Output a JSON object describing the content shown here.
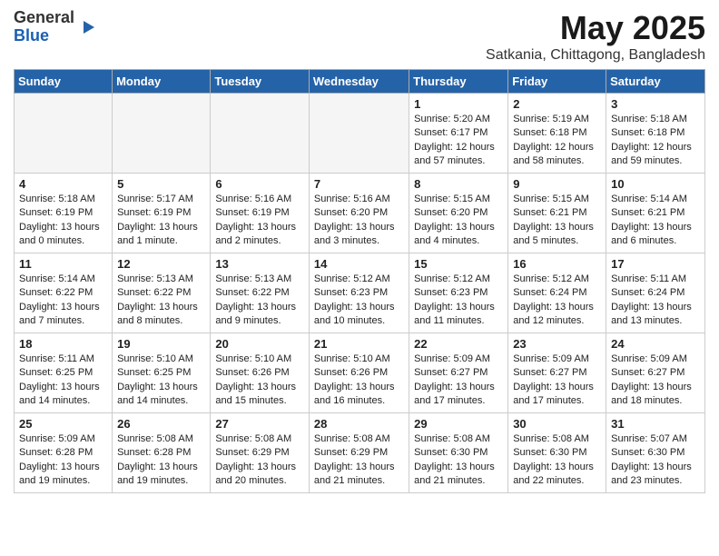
{
  "header": {
    "logo_general": "General",
    "logo_blue": "Blue",
    "title": "May 2025",
    "location": "Satkania, Chittagong, Bangladesh"
  },
  "weekdays": [
    "Sunday",
    "Monday",
    "Tuesday",
    "Wednesday",
    "Thursday",
    "Friday",
    "Saturday"
  ],
  "weeks": [
    [
      {
        "day": "",
        "empty": true
      },
      {
        "day": "",
        "empty": true
      },
      {
        "day": "",
        "empty": true
      },
      {
        "day": "",
        "empty": true
      },
      {
        "day": "1",
        "sunrise": "Sunrise: 5:20 AM",
        "sunset": "Sunset: 6:17 PM",
        "daylight": "Daylight: 12 hours and 57 minutes."
      },
      {
        "day": "2",
        "sunrise": "Sunrise: 5:19 AM",
        "sunset": "Sunset: 6:18 PM",
        "daylight": "Daylight: 12 hours and 58 minutes."
      },
      {
        "day": "3",
        "sunrise": "Sunrise: 5:18 AM",
        "sunset": "Sunset: 6:18 PM",
        "daylight": "Daylight: 12 hours and 59 minutes."
      }
    ],
    [
      {
        "day": "4",
        "sunrise": "Sunrise: 5:18 AM",
        "sunset": "Sunset: 6:19 PM",
        "daylight": "Daylight: 13 hours and 0 minutes."
      },
      {
        "day": "5",
        "sunrise": "Sunrise: 5:17 AM",
        "sunset": "Sunset: 6:19 PM",
        "daylight": "Daylight: 13 hours and 1 minute."
      },
      {
        "day": "6",
        "sunrise": "Sunrise: 5:16 AM",
        "sunset": "Sunset: 6:19 PM",
        "daylight": "Daylight: 13 hours and 2 minutes."
      },
      {
        "day": "7",
        "sunrise": "Sunrise: 5:16 AM",
        "sunset": "Sunset: 6:20 PM",
        "daylight": "Daylight: 13 hours and 3 minutes."
      },
      {
        "day": "8",
        "sunrise": "Sunrise: 5:15 AM",
        "sunset": "Sunset: 6:20 PM",
        "daylight": "Daylight: 13 hours and 4 minutes."
      },
      {
        "day": "9",
        "sunrise": "Sunrise: 5:15 AM",
        "sunset": "Sunset: 6:21 PM",
        "daylight": "Daylight: 13 hours and 5 minutes."
      },
      {
        "day": "10",
        "sunrise": "Sunrise: 5:14 AM",
        "sunset": "Sunset: 6:21 PM",
        "daylight": "Daylight: 13 hours and 6 minutes."
      }
    ],
    [
      {
        "day": "11",
        "sunrise": "Sunrise: 5:14 AM",
        "sunset": "Sunset: 6:22 PM",
        "daylight": "Daylight: 13 hours and 7 minutes."
      },
      {
        "day": "12",
        "sunrise": "Sunrise: 5:13 AM",
        "sunset": "Sunset: 6:22 PM",
        "daylight": "Daylight: 13 hours and 8 minutes."
      },
      {
        "day": "13",
        "sunrise": "Sunrise: 5:13 AM",
        "sunset": "Sunset: 6:22 PM",
        "daylight": "Daylight: 13 hours and 9 minutes."
      },
      {
        "day": "14",
        "sunrise": "Sunrise: 5:12 AM",
        "sunset": "Sunset: 6:23 PM",
        "daylight": "Daylight: 13 hours and 10 minutes."
      },
      {
        "day": "15",
        "sunrise": "Sunrise: 5:12 AM",
        "sunset": "Sunset: 6:23 PM",
        "daylight": "Daylight: 13 hours and 11 minutes."
      },
      {
        "day": "16",
        "sunrise": "Sunrise: 5:12 AM",
        "sunset": "Sunset: 6:24 PM",
        "daylight": "Daylight: 13 hours and 12 minutes."
      },
      {
        "day": "17",
        "sunrise": "Sunrise: 5:11 AM",
        "sunset": "Sunset: 6:24 PM",
        "daylight": "Daylight: 13 hours and 13 minutes."
      }
    ],
    [
      {
        "day": "18",
        "sunrise": "Sunrise: 5:11 AM",
        "sunset": "Sunset: 6:25 PM",
        "daylight": "Daylight: 13 hours and 14 minutes."
      },
      {
        "day": "19",
        "sunrise": "Sunrise: 5:10 AM",
        "sunset": "Sunset: 6:25 PM",
        "daylight": "Daylight: 13 hours and 14 minutes."
      },
      {
        "day": "20",
        "sunrise": "Sunrise: 5:10 AM",
        "sunset": "Sunset: 6:26 PM",
        "daylight": "Daylight: 13 hours and 15 minutes."
      },
      {
        "day": "21",
        "sunrise": "Sunrise: 5:10 AM",
        "sunset": "Sunset: 6:26 PM",
        "daylight": "Daylight: 13 hours and 16 minutes."
      },
      {
        "day": "22",
        "sunrise": "Sunrise: 5:09 AM",
        "sunset": "Sunset: 6:27 PM",
        "daylight": "Daylight: 13 hours and 17 minutes."
      },
      {
        "day": "23",
        "sunrise": "Sunrise: 5:09 AM",
        "sunset": "Sunset: 6:27 PM",
        "daylight": "Daylight: 13 hours and 17 minutes."
      },
      {
        "day": "24",
        "sunrise": "Sunrise: 5:09 AM",
        "sunset": "Sunset: 6:27 PM",
        "daylight": "Daylight: 13 hours and 18 minutes."
      }
    ],
    [
      {
        "day": "25",
        "sunrise": "Sunrise: 5:09 AM",
        "sunset": "Sunset: 6:28 PM",
        "daylight": "Daylight: 13 hours and 19 minutes."
      },
      {
        "day": "26",
        "sunrise": "Sunrise: 5:08 AM",
        "sunset": "Sunset: 6:28 PM",
        "daylight": "Daylight: 13 hours and 19 minutes."
      },
      {
        "day": "27",
        "sunrise": "Sunrise: 5:08 AM",
        "sunset": "Sunset: 6:29 PM",
        "daylight": "Daylight: 13 hours and 20 minutes."
      },
      {
        "day": "28",
        "sunrise": "Sunrise: 5:08 AM",
        "sunset": "Sunset: 6:29 PM",
        "daylight": "Daylight: 13 hours and 21 minutes."
      },
      {
        "day": "29",
        "sunrise": "Sunrise: 5:08 AM",
        "sunset": "Sunset: 6:30 PM",
        "daylight": "Daylight: 13 hours and 21 minutes."
      },
      {
        "day": "30",
        "sunrise": "Sunrise: 5:08 AM",
        "sunset": "Sunset: 6:30 PM",
        "daylight": "Daylight: 13 hours and 22 minutes."
      },
      {
        "day": "31",
        "sunrise": "Sunrise: 5:07 AM",
        "sunset": "Sunset: 6:30 PM",
        "daylight": "Daylight: 13 hours and 23 minutes."
      }
    ]
  ]
}
